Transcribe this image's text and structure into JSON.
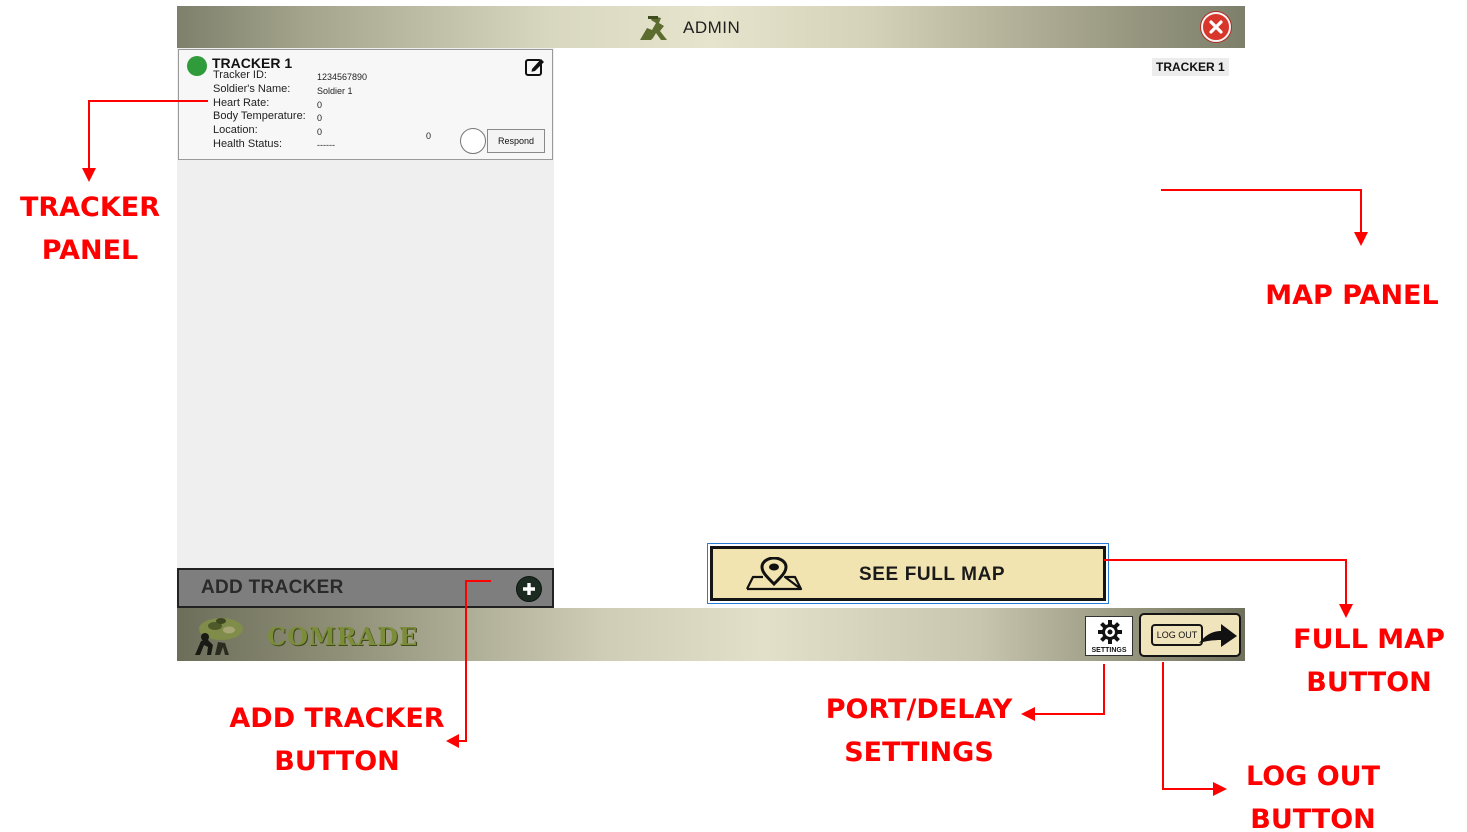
{
  "header": {
    "title": "ADMIN"
  },
  "tracker": {
    "title": "TRACKER 1",
    "status_color": "#2f9b3a",
    "fields": [
      {
        "label": "Tracker ID:",
        "value": "1234567890"
      },
      {
        "label": "Soldier's Name:",
        "value": "Soldier 1"
      },
      {
        "label": "Heart Rate:",
        "value": "0"
      },
      {
        "label": "Body Temperature:",
        "value": "0"
      },
      {
        "label": "Location:",
        "value": "0"
      },
      {
        "label": "Health Status:",
        "value": "------"
      }
    ],
    "location_extra": "0",
    "respond_label": "Respond"
  },
  "add_tracker_label": "ADD TRACKER",
  "map": {
    "tracker_label": "TRACKER 1",
    "full_map_label": "SEE FULL MAP"
  },
  "footer": {
    "brand": "COMRADE",
    "settings_label": "SETTINGS",
    "logout_label": "LOG OUT"
  },
  "annotations": {
    "tracker_panel": [
      "TRACKER",
      "PANEL"
    ],
    "map_panel": "MAP PANEL",
    "full_map_button": [
      "FULL MAP",
      "BUTTON"
    ],
    "add_tracker_button": [
      "ADD TRACKER",
      "BUTTON"
    ],
    "port_delay_settings": [
      "PORT/DELAY",
      "SETTINGS"
    ],
    "log_out_button": [
      "LOG OUT",
      "BUTTON"
    ],
    "color": "#ff0000"
  },
  "icons": [
    "admin-soldier-icon",
    "close-icon",
    "edit-icon",
    "plus-icon",
    "map-pin-icon",
    "gear-icon",
    "logout-arrow-icon",
    "soldier-logo"
  ]
}
